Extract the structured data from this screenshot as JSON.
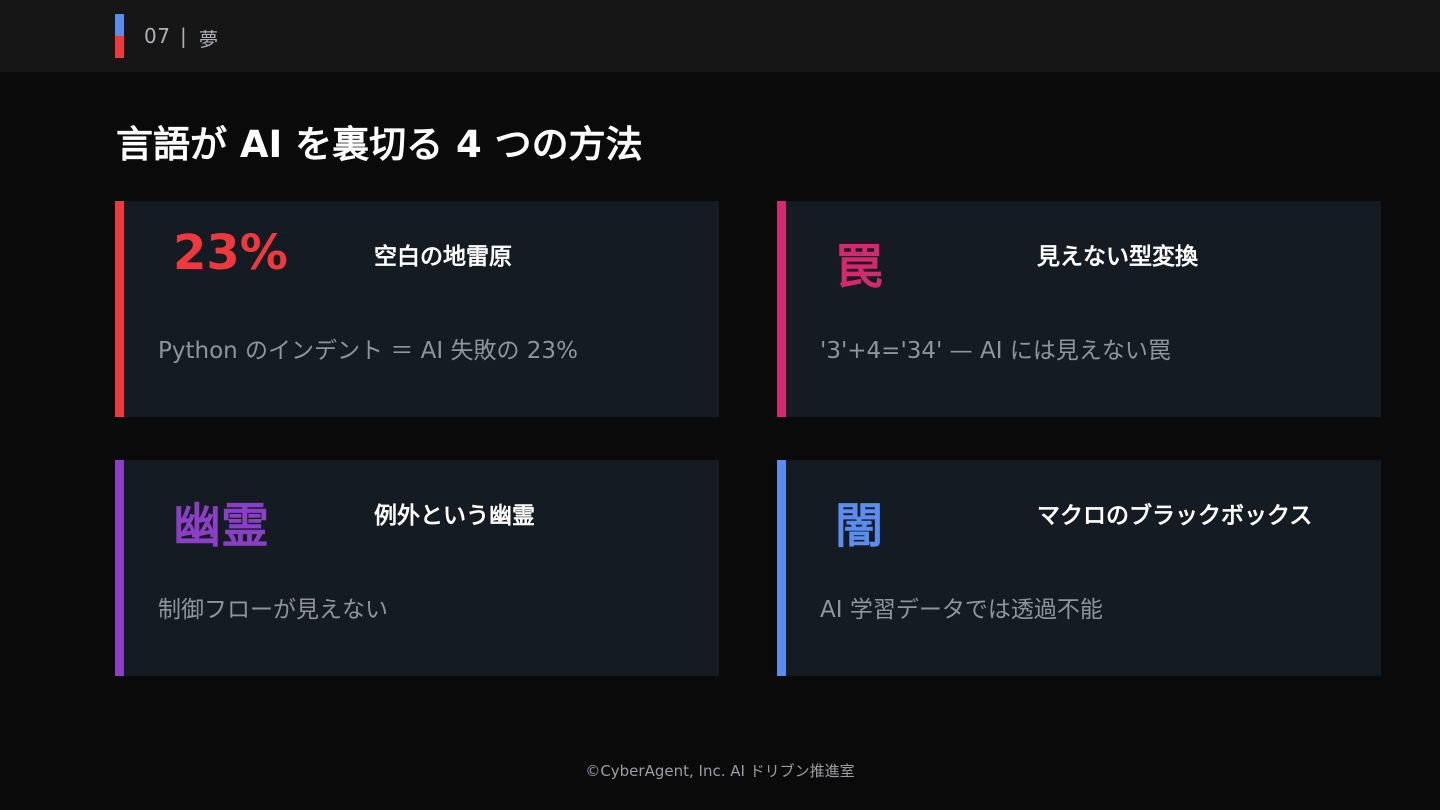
{
  "header": {
    "section_number": "07",
    "separator": "|",
    "section_title": "夢"
  },
  "title": "言語が AI を裏切る 4 つの方法",
  "cards": [
    {
      "big": "23%",
      "heading": "空白の地雷原",
      "description": "Python のインデント ＝ AI 失敗の 23%",
      "accent_color": "#f0383f"
    },
    {
      "big": "罠",
      "heading": "見えない型変換",
      "description": "'3'+4='34' — AI には見えない罠",
      "accent_color": "#d6286f"
    },
    {
      "big": "幽霊",
      "heading": "例外という幽霊",
      "description": "制御フローが見えない",
      "accent_color": "#8a3fc4"
    },
    {
      "big": "闇",
      "heading": "マクロのブラックボックス",
      "description": "AI 学習データでは透過不能",
      "accent_color": "#5b8def"
    }
  ],
  "footer": "©CyberAgent, Inc. AI ドリブン推進室"
}
